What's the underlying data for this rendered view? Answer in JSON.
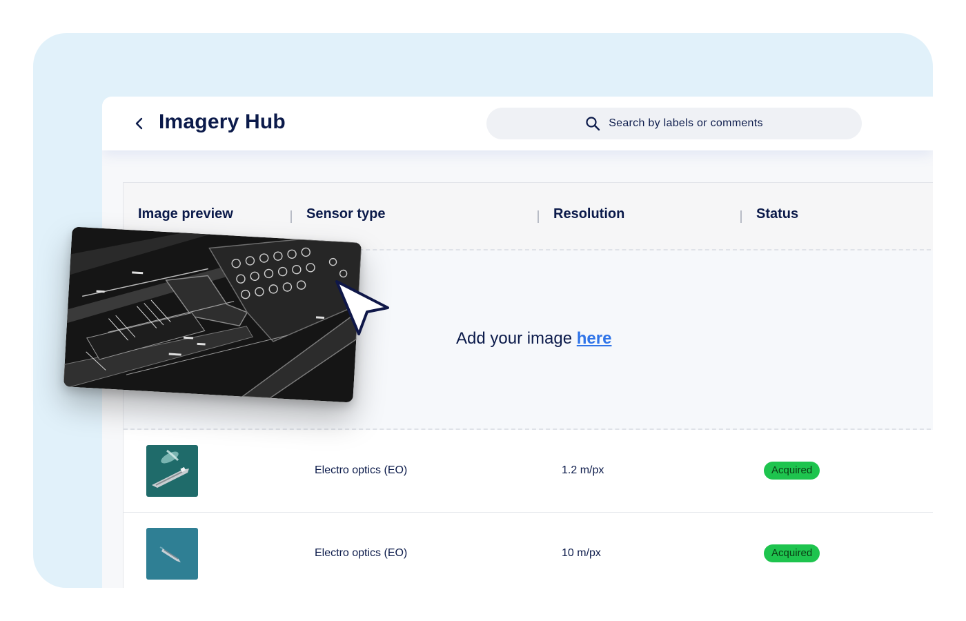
{
  "header": {
    "title": "Imagery Hub",
    "search_placeholder": "Search by labels or comments"
  },
  "table": {
    "columns": [
      "Image preview",
      "Sensor type",
      "Resolution",
      "Status"
    ],
    "dropzone": {
      "text": "Add your image ",
      "link": "here"
    },
    "rows": [
      {
        "sensor": "Electro optics (EO)",
        "resolution": "1.2 m/px",
        "status": "Acquired"
      },
      {
        "sensor": "Electro optics (EO)",
        "resolution": "10 m/px",
        "status": "Acquired"
      }
    ]
  },
  "colors": {
    "backdrop": "#e1f1fa",
    "title_text": "#0b1a4a",
    "link": "#2f74e8",
    "status_acquired": "#1ec44e"
  },
  "icons": [
    "chevron-left-icon",
    "search-icon",
    "cursor-arrow-icon"
  ]
}
